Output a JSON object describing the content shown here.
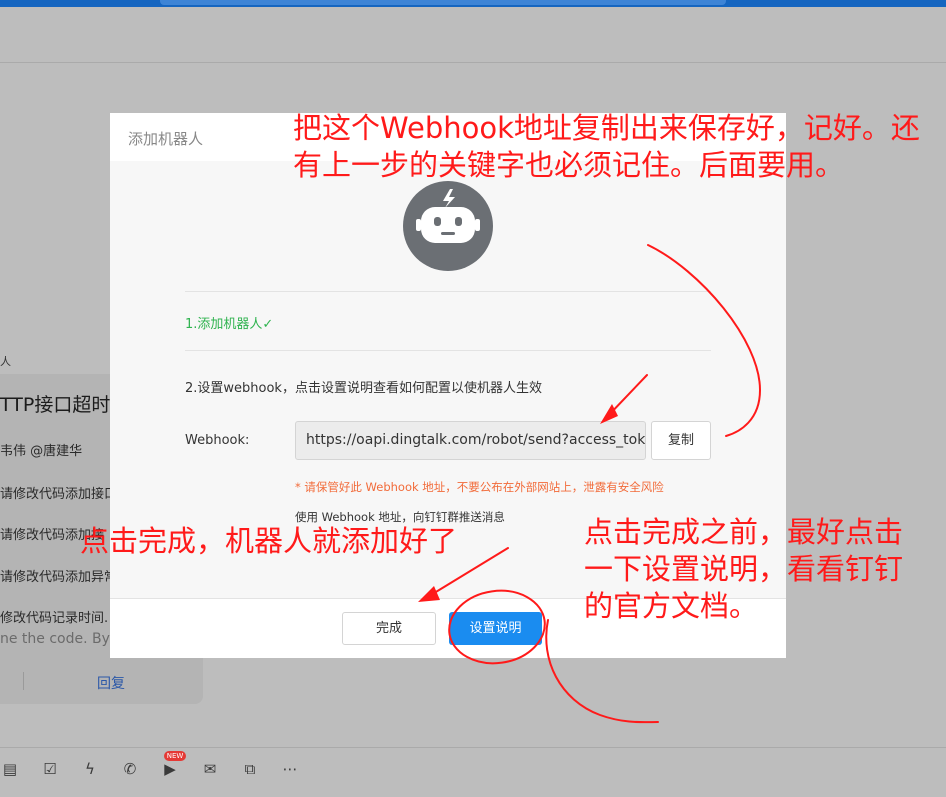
{
  "background": {
    "tiny_label": "人",
    "chat_title": "TTP接口超时",
    "author_line": "韦伟 @唐建华",
    "lines": [
      "请修改代码添加接口",
      "请修改代码添加接",
      "请修改代码添加异常",
      "修改代码记录时间."
    ],
    "faint_line": "ne the code. By z",
    "reply_label": "回复",
    "new_badge": "NEW"
  },
  "dialog": {
    "title": "添加机器人",
    "step1": "1.添加机器人✓",
    "step2": "2.设置webhook，点击设置说明查看如何配置以使机器人生效",
    "webhook_label": "Webhook:",
    "webhook_value": "https://oapi.dingtalk.com/robot/send?access_tok",
    "copy_button": "复制",
    "warning": "* 请保管好此 Webhook 地址，不要公布在外部网站上，泄露有安全风险",
    "usage": "使用 Webhook 地址，向钉钉群推送消息",
    "done_button": "完成",
    "help_button": "设置说明"
  },
  "annotations": {
    "top": "把这个Webhook地址复制出来保存好，记好。还有上一步的关键字也必须记住。后面要用。",
    "left": "点击完成，机器人就添加好了",
    "right": "点击完成之前，最好点击一下设置说明，看看钉钉的官方文档。"
  },
  "colors": {
    "accent": "#1a8cf0",
    "success": "#2fb34f",
    "warning": "#f26b3a",
    "annotation": "#ff1a1a"
  }
}
